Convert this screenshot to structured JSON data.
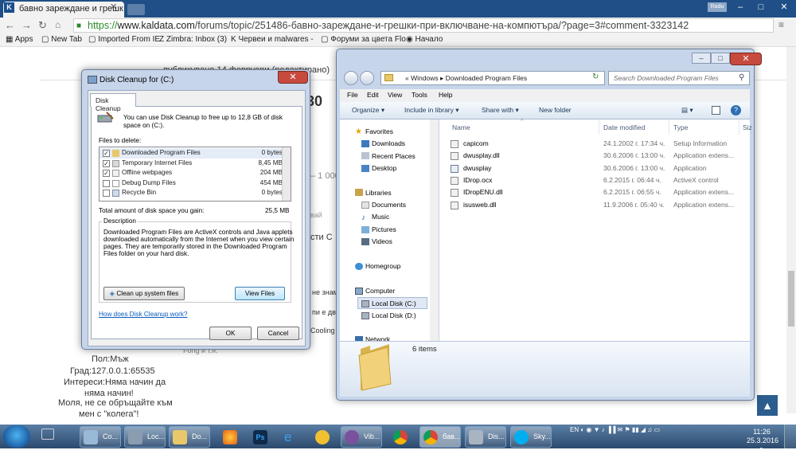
{
  "browser": {
    "tab_title": "бавно зареждане и грешк",
    "url_scheme": "https://",
    "url_host": "www.kaldata.com",
    "url_path": "/forums/topic/251486-бавно-зареждане-и-грешки-при-включване-на-компютъра/?page=3#comment-3323142",
    "user": "Radu",
    "bookmarks": [
      "Apps",
      "New Tab",
      "Imported From IE",
      "Zimbra: Inbox (3)",
      "Червеи и malwares -",
      "Форуми за цвета Flo",
      "Начало"
    ]
  },
  "page": {
    "posted": "публикувано 14 февруари (редактирано)",
    "big_number": "30",
    "snippet1": "– 1 000",
    "snippet2": "вай",
    "snippet3": "сти С",
    "snippet4": "не знам",
    "snippet5": "пи е два",
    "snippet6": "Cooling и",
    "snippet7": "Fong и т.н.",
    "profile_gender": "Пол:Мъж",
    "profile_city": "Град:127.0.0.1:65535",
    "profile_interests_1": "Интереси:Няма начин да",
    "profile_interests_2": "няма начин!",
    "profile_note_1": "Моля, не се обръщайте към",
    "profile_note_2": "мен с \"колега\"!"
  },
  "disk_cleanup": {
    "title": "Disk Cleanup for  (C:)",
    "tab": "Disk Cleanup",
    "intro_1": "You can use Disk Cleanup to free up to 12,8 GB of disk",
    "intro_2": "space on  (C:).",
    "files_label": "Files to delete:",
    "files": [
      {
        "name": "Downloaded Program Files",
        "size": "0 bytes",
        "checked": true
      },
      {
        "name": "Temporary Internet Files",
        "size": "8,45 MB",
        "checked": true
      },
      {
        "name": "Offline webpages",
        "size": "204 MB",
        "checked": true
      },
      {
        "name": "Debug Dump Files",
        "size": "454 MB",
        "checked": false
      },
      {
        "name": "Recycle Bin",
        "size": "0 bytes",
        "checked": false
      }
    ],
    "total_label": "Total amount of disk space you gain:",
    "total_value": "25,5 MB",
    "description_label": "Description",
    "description": [
      "Downloaded Program Files are ActiveX controls and Java applets",
      "downloaded automatically from the Internet when you view certain",
      "pages. They are temporarily stored in the Downloaded Program",
      "Files folder on your hard disk."
    ],
    "cleanup_button": "Clean up system files",
    "view_files_button": "View Files",
    "help_link": "How does Disk Cleanup work?",
    "ok_button": "OK",
    "cancel_button": "Cancel"
  },
  "explorer": {
    "breadcrumb": [
      "«",
      "Windows",
      "Downloaded Program Files"
    ],
    "search_placeholder": "Search Downloaded Program Files",
    "menu": [
      "File",
      "Edit",
      "View",
      "Tools",
      "Help"
    ],
    "commands": [
      "Organize ▾",
      "Include in library ▾",
      "Share with ▾",
      "New folder"
    ],
    "nav": {
      "favorites": "Favorites",
      "fav_items": [
        "Downloads",
        "Recent Places",
        "Desktop"
      ],
      "libraries": "Libraries",
      "lib_items": [
        "Documents",
        "Music",
        "Pictures",
        "Videos"
      ],
      "homegroup": "Homegroup",
      "computer": "Computer",
      "drives": [
        "Local Disk (C:)",
        "Local Disk (D:)"
      ],
      "network": "Network"
    },
    "columns": [
      "Name",
      "Date modified",
      "Type",
      "Siz"
    ],
    "files": [
      {
        "name": "capicom",
        "date": "24.1.2002 г. 17:34 ч.",
        "type": "Setup Information"
      },
      {
        "name": "dwusplay.dll",
        "date": "30.6.2006 г. 13:00 ч.",
        "type": "Application extens..."
      },
      {
        "name": "dwusplay",
        "date": "30.6.2006 г. 13:00 ч.",
        "type": "Application"
      },
      {
        "name": "IDrop.ocx",
        "date": "6.2.2015 г. 06:44 ч.",
        "type": "ActiveX control"
      },
      {
        "name": "IDropENU.dll",
        "date": "6.2.2015 г. 06:55 ч.",
        "type": "Application extens..."
      },
      {
        "name": "isusweb.dll",
        "date": "11.9.2006 г. 05:40 ч.",
        "type": "Application extens..."
      }
    ],
    "item_count": "6 items"
  },
  "taskbar": {
    "items": [
      "Co...",
      "Loc...",
      "Do...",
      "Vib...",
      "бав...",
      "Dis...",
      "Sky..."
    ],
    "lang": "EN",
    "time": "11:26",
    "date": "25.3.2016 г."
  },
  "colors": {
    "titlebar": "#1f4f86",
    "close": "#c74a3e",
    "link": "#0a5cc0"
  }
}
